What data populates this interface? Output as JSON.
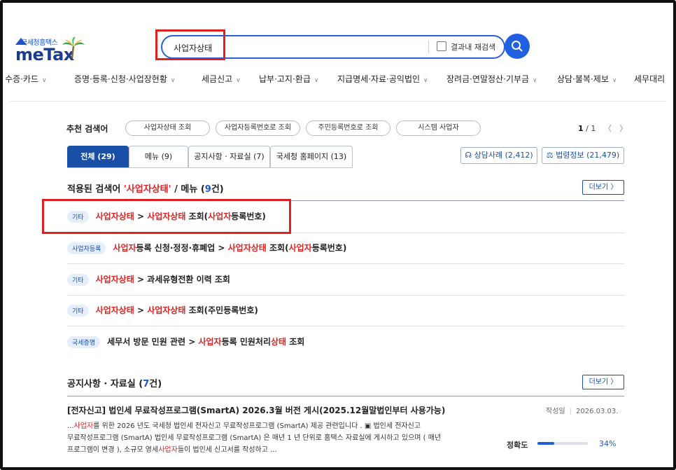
{
  "logo": {
    "small": "국세청홈택스",
    "big": "meTax"
  },
  "search": {
    "query": "사업자상태",
    "within_label": "결과내 재검색"
  },
  "nav": [
    {
      "label": "영수증·카드"
    },
    {
      "label": "증명·등록·신청·사업장현황"
    },
    {
      "label": "세금신고"
    },
    {
      "label": "납부·고지·환급"
    },
    {
      "label": "지급명세·자료·공익법인"
    },
    {
      "label": "장려금·연말정산·기부금"
    },
    {
      "label": "상담·불복·제보"
    },
    {
      "label": "세무대리"
    }
  ],
  "recommended": {
    "label": "추천 검색어",
    "chips": [
      "사업자상태 조회",
      "사업자등록번호로 조회",
      "주민등록번호로 조회",
      "시스템 사업자"
    ],
    "page_current": "1",
    "page_total": " / 1"
  },
  "tabs": [
    {
      "label": "전체 (29)"
    },
    {
      "label": "메뉴 (9)"
    },
    {
      "label": "공지사항 · 자료실 (7)"
    },
    {
      "label": "국세청 홈페이지 (13)"
    }
  ],
  "right_buttons": {
    "consult": "상담사례 (2,412)",
    "law": "법령정보 (21,479)"
  },
  "menu_section": {
    "prefix": "적용된 검색어 ",
    "keyword": "'사업자상태'",
    "middle": " / 메뉴 (",
    "count": "9",
    "suffix": "건)",
    "more": "더보기 〉",
    "rows": [
      {
        "badge": "기타",
        "parts": [
          {
            "t": "사업자상태",
            "hl": true
          },
          {
            "t": " > ",
            "hl": false
          },
          {
            "t": "사업자상태",
            "hl": true
          },
          {
            "t": " 조회(",
            "hl": false
          },
          {
            "t": "사업자",
            "hl": true
          },
          {
            "t": "등록번호)",
            "hl": false
          }
        ]
      },
      {
        "badge": "사업자등록",
        "parts": [
          {
            "t": "사업자",
            "hl": true
          },
          {
            "t": "등록 신청·정정·휴폐업 > ",
            "hl": false
          },
          {
            "t": "사업자상태",
            "hl": true
          },
          {
            "t": " 조회(",
            "hl": false
          },
          {
            "t": "사업자",
            "hl": true
          },
          {
            "t": "등록번호)",
            "hl": false
          }
        ]
      },
      {
        "badge": "기타",
        "parts": [
          {
            "t": "사업자상태",
            "hl": true
          },
          {
            "t": " > 과세유형전환 이력 조회",
            "hl": false
          }
        ]
      },
      {
        "badge": "기타",
        "parts": [
          {
            "t": "사업자상태",
            "hl": true
          },
          {
            "t": " > ",
            "hl": false
          },
          {
            "t": "사업자상태",
            "hl": true
          },
          {
            "t": " 조회(주민등록번호)",
            "hl": false
          }
        ]
      },
      {
        "badge": "국세증명",
        "parts": [
          {
            "t": "세무서 방문 민원 관련 > ",
            "hl": false
          },
          {
            "t": "사업자",
            "hl": true
          },
          {
            "t": "등록 민원처리",
            "hl": false
          },
          {
            "t": "상태",
            "hl": true
          },
          {
            "t": " 조회",
            "hl": false
          }
        ]
      }
    ]
  },
  "notice_section": {
    "prefix": "공지사항 · 자료실 (",
    "count": "7",
    "suffix": "건)",
    "more": "더보기 〉",
    "item": {
      "title": "[전자신고] 법인세 무료작성프로그램(SmartA) 2026.3월 버전 게시(2025.12월말법인부터 사용가능)",
      "meta_label": "작성일",
      "date": "2026.03.03.",
      "line1": [
        {
          "t": "...",
          "hl": false
        },
        {
          "t": "사업자",
          "hl": true
        },
        {
          "t": "를 위한 2026 년도 국세청 법인세 전자신고 무료작성프로그램 (SmartA) 제공 관련입니다 . ▣ 법인세 전자신고",
          "hl": false
        }
      ],
      "line2": [
        {
          "t": "무료작성프로그램 (SmartA) 법인세 무료작성프로그램 (SmartA) 은 매년 1 년 단위로 홈택스 자료실에 게시하고 있으며 ( 매년",
          "hl": false
        }
      ],
      "line3": [
        {
          "t": "프로그램이 변경 ), 소규모 영세",
          "hl": false
        },
        {
          "t": "사업자",
          "hl": true
        },
        {
          "t": "들이 법인세 신고서를 작성하고 ...",
          "hl": false
        }
      ],
      "accuracy_label": "정확도",
      "accuracy_value": "34%",
      "accuracy_fraction": 0.34
    }
  },
  "colors": {
    "primary": "#1a4fa8",
    "accent": "#1f5fe0",
    "highlight": "#e02424",
    "annotation": "#e02020"
  }
}
